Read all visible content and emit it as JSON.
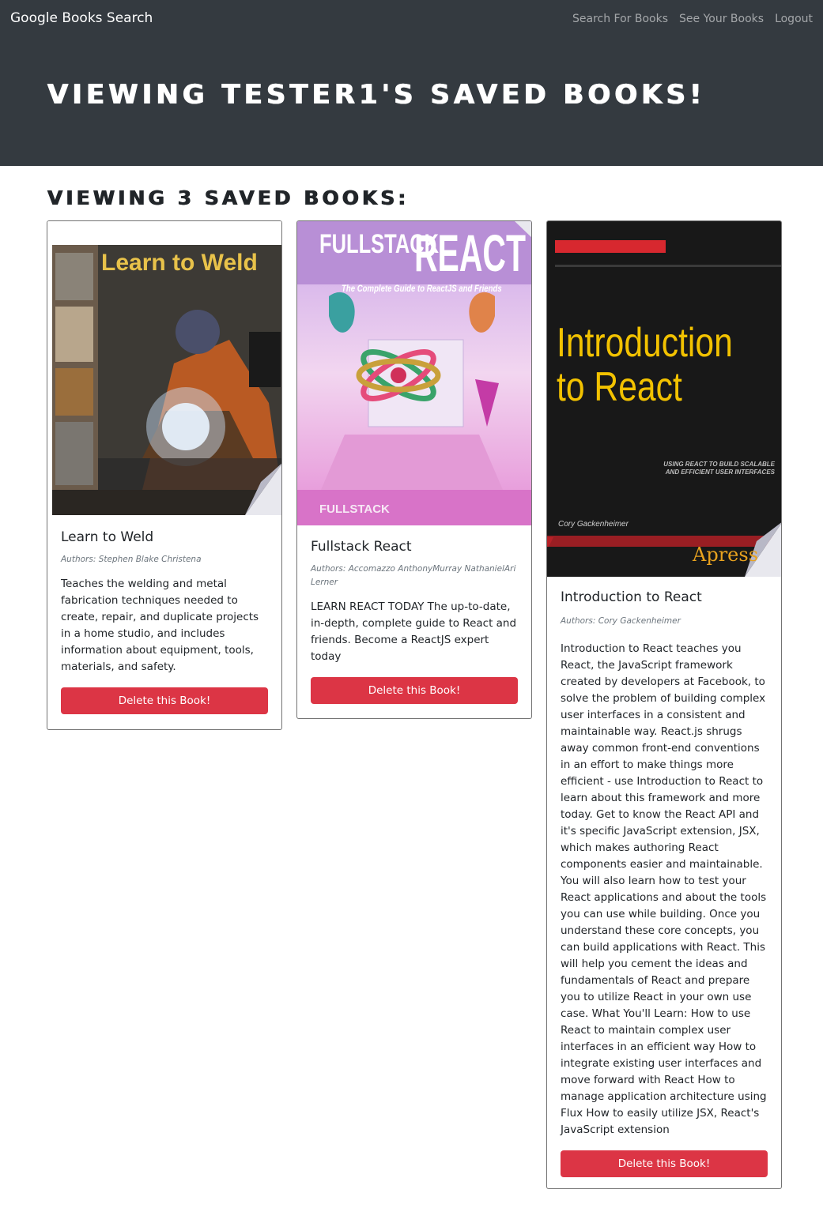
{
  "navbar": {
    "brand": "Google Books Search",
    "links": [
      {
        "label": "Search For Books"
      },
      {
        "label": "See Your Books"
      },
      {
        "label": "Logout"
      }
    ]
  },
  "hero": {
    "title": "VIEWING TESTER1'S SAVED BOOKS!"
  },
  "section": {
    "title": "VIEWING 3 SAVED BOOKS:"
  },
  "books": [
    {
      "title": "Learn to Weld",
      "authors": "Authors: Stephen Blake Christena",
      "description": "Teaches the welding and metal fabrication techniques needed to create, repair, and duplicate projects in a home studio, and includes information about equipment, tools, materials, and safety.",
      "button_label": "Delete this Book!",
      "cover": {
        "line1": "Learn to Weld",
        "colors": {
          "bg": "#1b1b1b",
          "accent": "#e8c24a"
        }
      }
    },
    {
      "title": "Fullstack React",
      "authors": "Authors: Accomazzo AnthonyMurray NathanielAri Lerner",
      "description": "LEARN REACT TODAY The up-to-date, in-depth, complete guide to React and friends. Become a ReactJS expert today",
      "button_label": "Delete this Book!",
      "cover": {
        "line1": "FULLSTACK",
        "line2": "REACT",
        "subtitle": "The Complete Guide to ReactJS and Friends",
        "footer": "FULLSTACK",
        "colors": {
          "bg": "#e8a3d9",
          "accent": "#ffffff"
        }
      }
    },
    {
      "title": "Introduction to React",
      "authors": "Authors: Cory Gackenheimer",
      "description": "Introduction to React teaches you React, the JavaScript framework created by developers at Facebook, to solve the problem of building complex user interfaces in a consistent and maintainable way. React.js shrugs away common front-end conventions in an effort to make things more efficient - use Introduction to React to learn about this framework and more today. Get to know the React API and it's specific JavaScript extension, JSX, which makes authoring React components easier and maintainable. You will also learn how to test your React applications and about the tools you can use while building. Once you understand these core concepts, you can build applications with React. This will help you cement the ideas and fundamentals of React and prepare you to utilize React in your own use case. What You'll Learn: How to use React to maintain complex user interfaces in an efficient way How to integrate existing user interfaces and move forward with React How to manage application architecture using Flux How to easily utilize JSX, React's JavaScript extension",
      "button_label": "Delete this Book!",
      "cover": {
        "line1": "Introduction",
        "line2": "to React",
        "tagline": "USING REACT TO BUILD SCALABLE AND EFFICIENT USER INTERFACES",
        "author": "Cory Gackenheimer",
        "publisher": "Apress",
        "colors": {
          "bg": "#111111",
          "accent": "#f2c200",
          "stripe": "#d7282f"
        }
      }
    }
  ]
}
